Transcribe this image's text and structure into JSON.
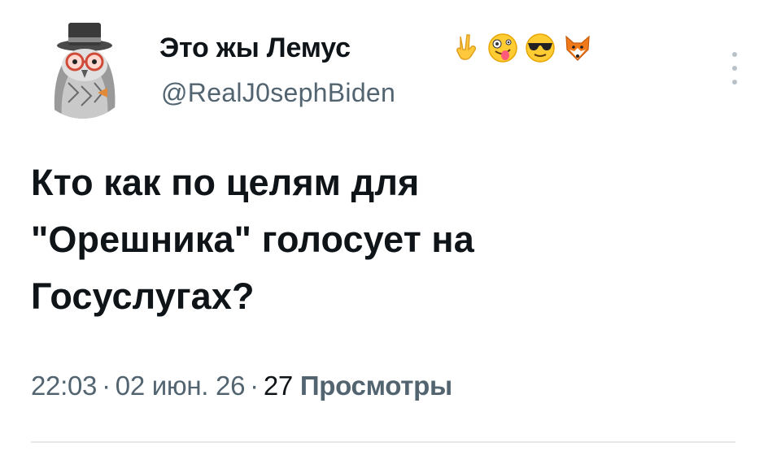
{
  "author": {
    "display_name": "Это жы Лемус",
    "handle": "@RealJ0sephBiden",
    "avatar_icon": "owl-with-top-hat-avatar",
    "name_emojis": [
      "victory-hand-icon",
      "zany-face-icon",
      "sunglasses-face-icon",
      "fox-face-icon"
    ]
  },
  "tweet": {
    "text": "Кто как по целям для\n\"Орешника\" голосует на\nГосуслугах?",
    "time": "22:03",
    "date": "02 июн. 26",
    "separator": "·",
    "views_count": "27",
    "views_label": "Просмотры"
  },
  "colors": {
    "text": "#0f1419",
    "secondary": "#536471",
    "divider": "#e6e8ea"
  }
}
